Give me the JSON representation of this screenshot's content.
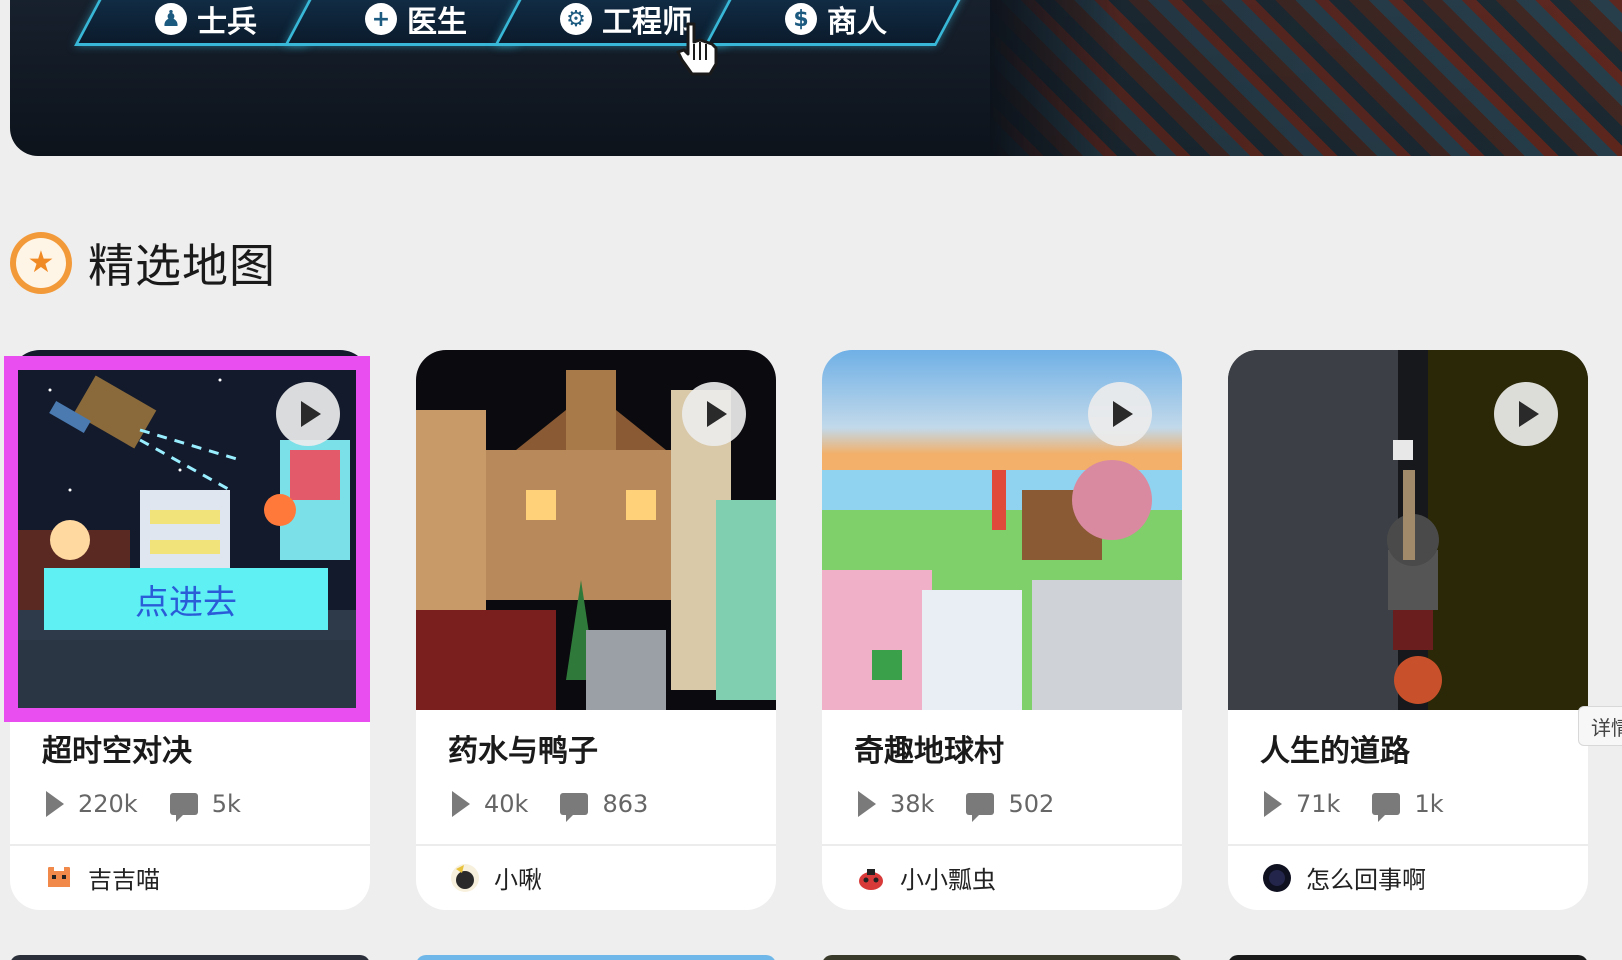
{
  "hero": {
    "tabs": [
      {
        "label": "士兵",
        "icon": "person-icon"
      },
      {
        "label": "医生",
        "icon": "plus-icon"
      },
      {
        "label": "工程师",
        "icon": "gear-icon"
      },
      {
        "label": "商人",
        "icon": "dollar-icon"
      }
    ]
  },
  "section": {
    "title": "精选地图",
    "icon": "star-icon",
    "accent": "#f29a3a"
  },
  "cards": [
    {
      "title": "超时空对决",
      "plays": "220k",
      "comments": "5k",
      "author": "吉吉喵",
      "overlay_label": "点进去"
    },
    {
      "title": "药水与鸭子",
      "plays": "40k",
      "comments": "863",
      "author": "小啾"
    },
    {
      "title": "奇趣地球村",
      "plays": "38k",
      "comments": "502",
      "author": "小小瓢虫"
    },
    {
      "title": "人生的道路",
      "plays": "71k",
      "comments": "1k",
      "author": "怎么回事啊"
    }
  ],
  "details_tab": {
    "label": "详情"
  },
  "colors": {
    "background": "#eeeeee",
    "highlight": "#e94ef1",
    "overlay_bg": "#5ff0f4",
    "overlay_text": "#2a5cd8"
  }
}
